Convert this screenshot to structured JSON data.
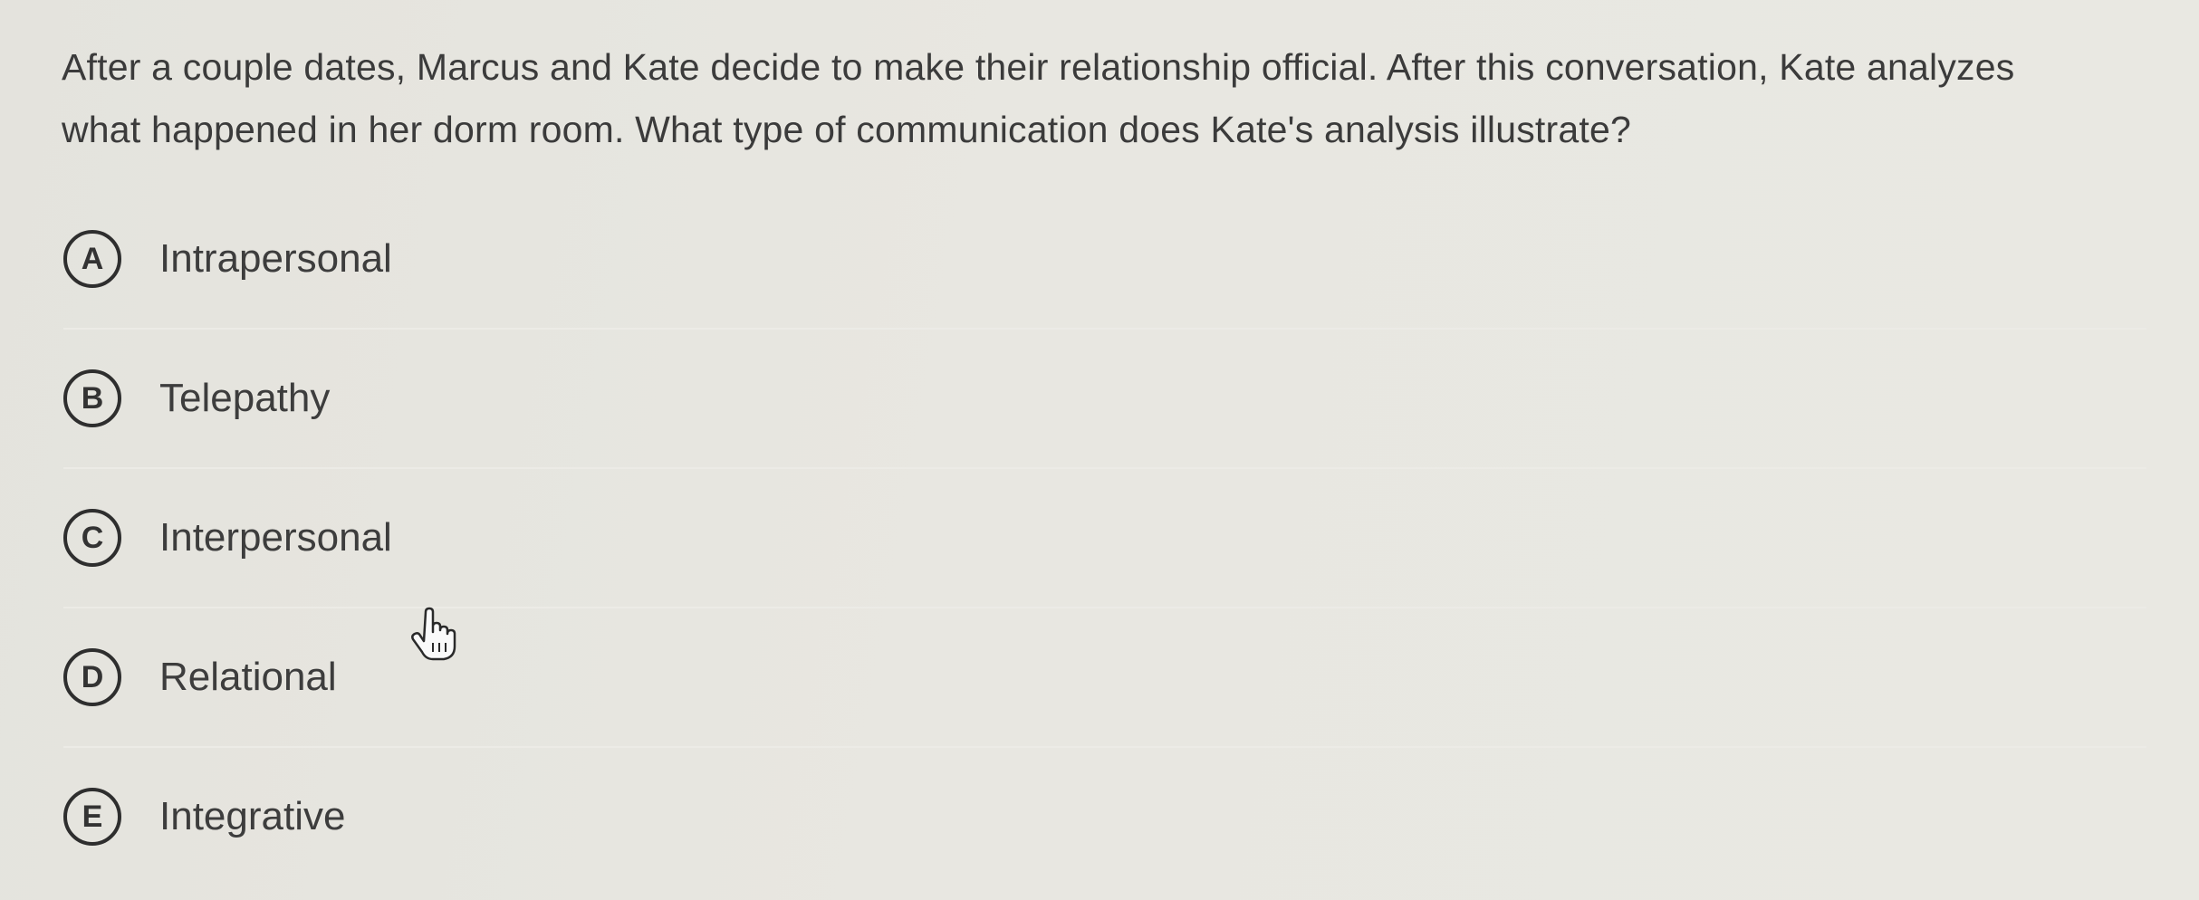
{
  "question": {
    "text": "After a couple dates, Marcus and Kate decide to make their relationship official. After this conversation, Kate analyzes what happened in her dorm room. What type of communication does Kate's analysis illustrate?"
  },
  "options": [
    {
      "letter": "A",
      "label": "Intrapersonal"
    },
    {
      "letter": "B",
      "label": "Telepathy"
    },
    {
      "letter": "C",
      "label": "Interpersonal"
    },
    {
      "letter": "D",
      "label": "Relational"
    },
    {
      "letter": "E",
      "label": "Integrative"
    }
  ],
  "icons": {
    "cursor": "hand-pointer-icon"
  }
}
